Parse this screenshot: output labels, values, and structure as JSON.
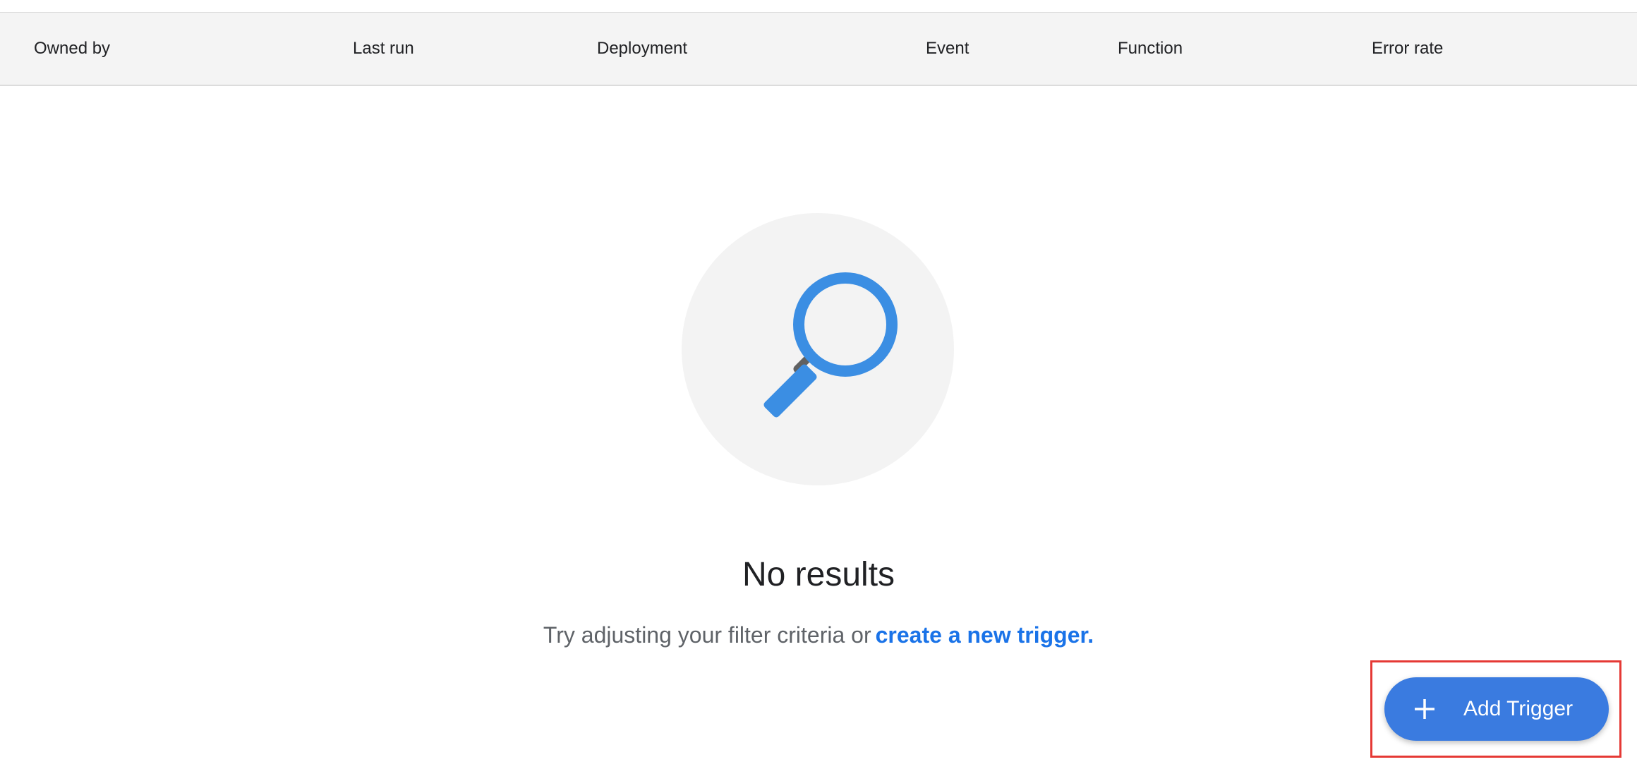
{
  "table": {
    "columns": [
      "Owned by",
      "Last run",
      "Deployment",
      "Event",
      "Function",
      "Error rate"
    ]
  },
  "empty_state": {
    "illustration_icon": "search-icon",
    "title": "No results",
    "description": "Try adjusting your filter criteria or",
    "link_text": "create a new trigger."
  },
  "fab": {
    "icon": "plus-icon",
    "label": "Add Trigger"
  },
  "colors": {
    "accent": "#3a7be0",
    "link": "#1a73e8",
    "header_bg": "#f4f4f4",
    "highlight": "#e53935"
  }
}
